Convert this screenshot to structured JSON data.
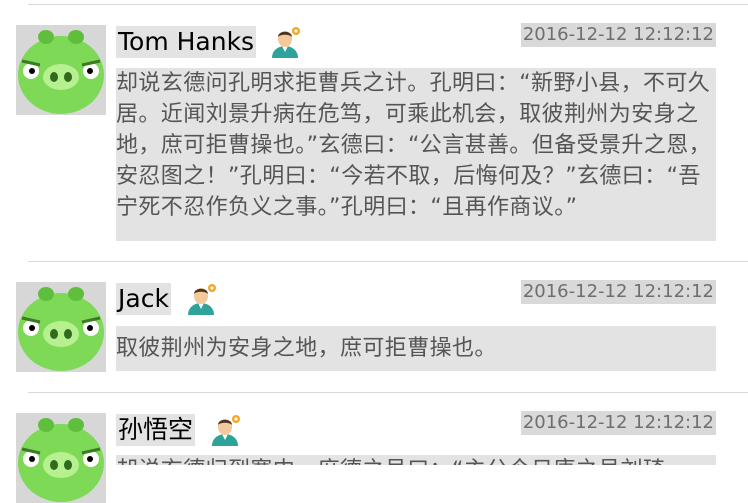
{
  "posts": [
    {
      "name": "Tom Hanks",
      "time": "2016-12-12 12:12:12",
      "content": "却说玄德问孔明求拒曹兵之计。孔明曰：“新野小县，不可久居。近闻刘景升病在危笃，可乘此机会，取彼荆州为安身之地，庶可拒曹操也。”玄德曰：“公言甚善。但备受景升之恩，安忍图之！”孔明曰：“今若不取，后悔何及？”玄德曰：“吾宁死不忍作负义之事。”孔明曰：“且再作商议。”"
    },
    {
      "name": "Jack",
      "time": "2016-12-12 12:12:12",
      "content": "取彼荆州为安身之地，庶可拒曹操也。"
    },
    {
      "name": "孙悟空",
      "time": "2016-12-12 12:12:12",
      "content": "却说玄德归到寨中，庶德之号曰：“主公今日康之号刘琦"
    }
  ],
  "icons": {
    "avatar": "green-pig-avatar-icon",
    "user": "user-badge-icon"
  },
  "colors": {
    "name_bg": "#e3e3e3",
    "time_text": "#6e6e6e",
    "content_text": "#555555",
    "pig_green": "#7ed957"
  }
}
